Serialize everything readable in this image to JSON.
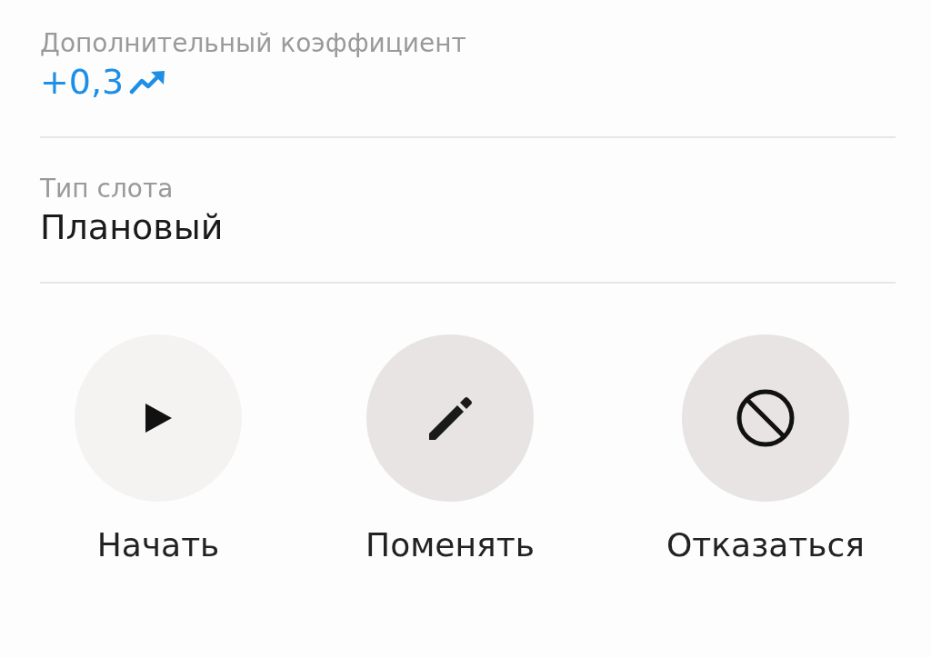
{
  "fields": [
    {
      "label": "Дополнительный коэффициент",
      "value": "+0,3",
      "kind": "trend"
    },
    {
      "label": "Тип слота",
      "value": "Плановый",
      "kind": "plain"
    }
  ],
  "actions": [
    {
      "label": "Начать",
      "kind": "play"
    },
    {
      "label": "Поменять",
      "kind": "edit"
    },
    {
      "label": "Отказаться",
      "kind": "cancel"
    }
  ]
}
